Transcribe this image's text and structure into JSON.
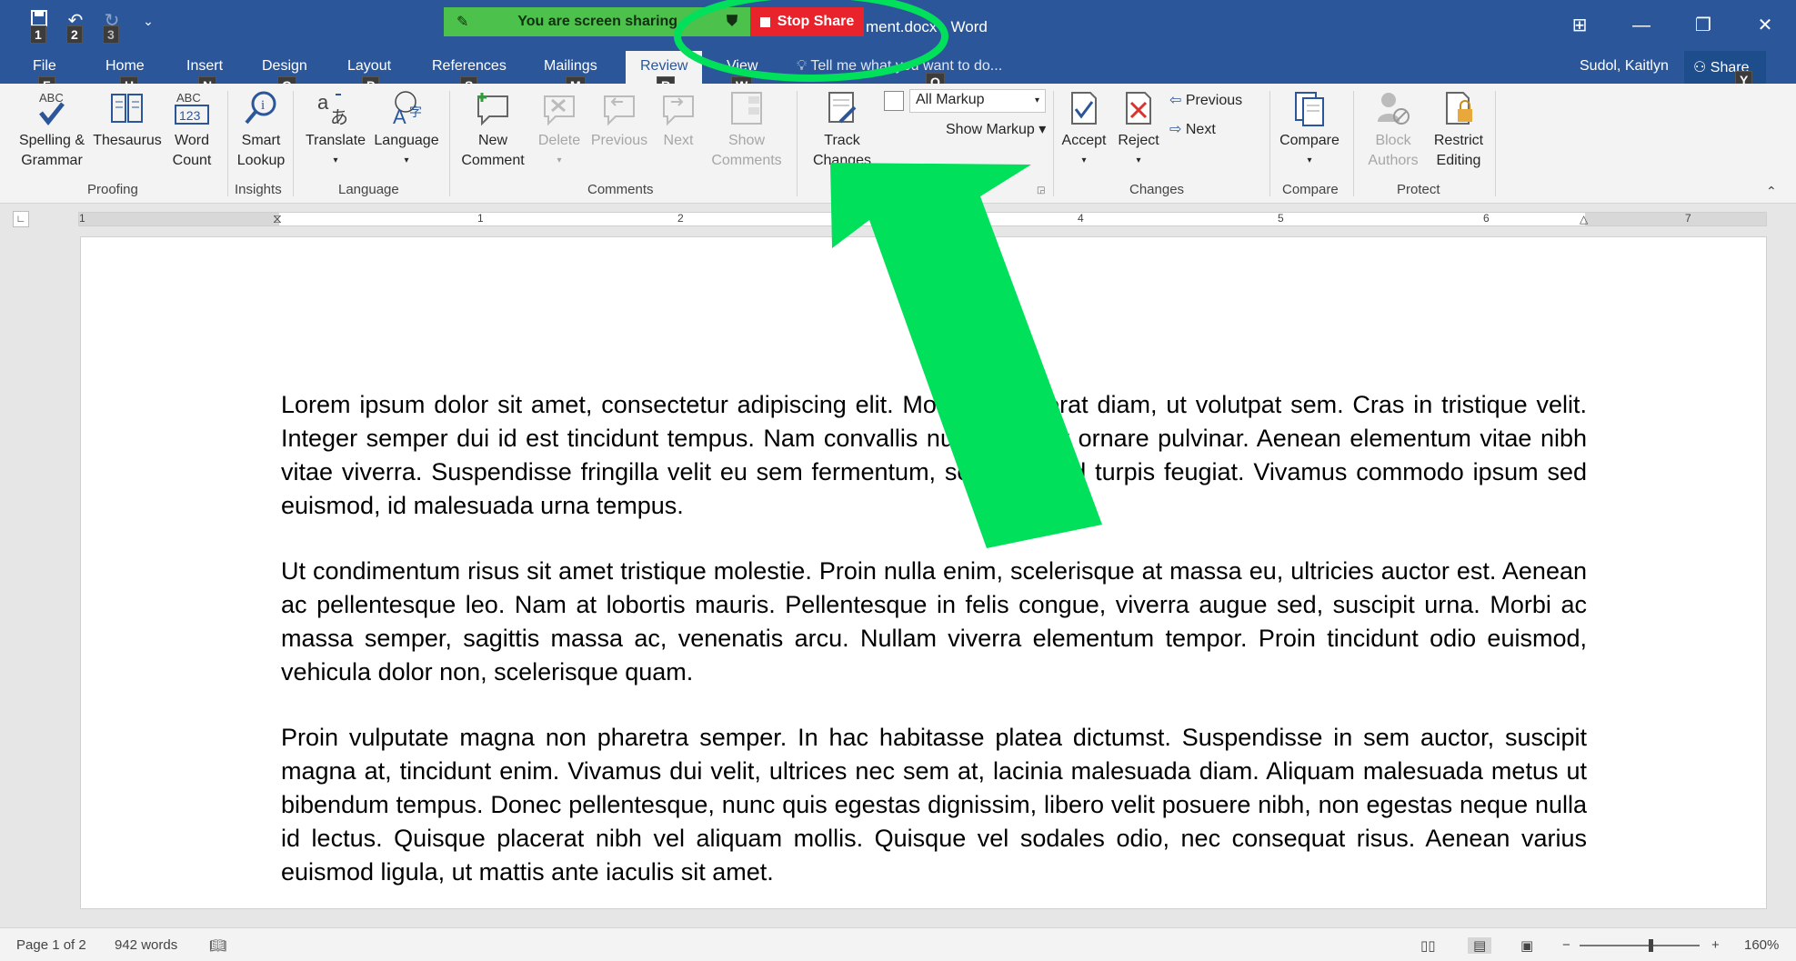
{
  "window": {
    "title": "ment.docx - Word",
    "controls": [
      "ribbon-display",
      "minimize",
      "restore",
      "close"
    ]
  },
  "share_banner": {
    "status": "You are screen sharing",
    "stop_label": "Stop Share"
  },
  "qat_keytips": [
    "1",
    "2",
    "3"
  ],
  "tabs": [
    {
      "label": "File",
      "keytip": "F"
    },
    {
      "label": "Home",
      "keytip": "H"
    },
    {
      "label": "Insert",
      "keytip": "N"
    },
    {
      "label": "Design",
      "keytip": "G"
    },
    {
      "label": "Layout",
      "keytip": "P"
    },
    {
      "label": "References",
      "keytip": "S"
    },
    {
      "label": "Mailings",
      "keytip": "M"
    },
    {
      "label": "Review",
      "keytip": "R"
    },
    {
      "label": "View",
      "keytip": "W"
    }
  ],
  "tell_me": "Tell me what you want to do...",
  "tell_me_keytip": "Q",
  "user": "Sudol, Kaitlyn",
  "share_button": {
    "label": "Share",
    "keytip": "Y"
  },
  "ribbon": {
    "proofing": {
      "label": "Proofing",
      "spelling_1": "Spelling &",
      "spelling_2": "Grammar",
      "thesaurus": "Thesaurus",
      "wordcount_1": "Word",
      "wordcount_2": "Count"
    },
    "insights": {
      "label": "Insights",
      "smart_1": "Smart",
      "smart_2": "Lookup"
    },
    "language": {
      "label": "Language",
      "translate": "Translate",
      "language": "Language"
    },
    "comments": {
      "label": "Comments",
      "new_1": "New",
      "new_2": "Comment",
      "delete": "Delete",
      "previous": "Previous",
      "next": "Next",
      "show_1": "Show",
      "show_2": "Comments"
    },
    "tracking": {
      "track_1": "Track",
      "track_2": "Changes",
      "markup_value": "All Markup",
      "show_markup": "Show Markup"
    },
    "changes": {
      "label": "Changes",
      "accept": "Accept",
      "reject": "Reject",
      "previous": "Previous",
      "next": "Next"
    },
    "compare": {
      "label": "Compare",
      "compare": "Compare"
    },
    "protect": {
      "label": "Protect",
      "block_1": "Block",
      "block_2": "Authors",
      "restrict_1": "Restrict",
      "restrict_2": "Editing"
    }
  },
  "ruler_numbers": [
    "1",
    "1",
    "2",
    "3",
    "4",
    "5",
    "6",
    "7"
  ],
  "document": {
    "paragraphs": [
      "Lorem ipsum dolor sit amet, consectetur adipiscing elit. Morbi id placerat diam, ut volutpat sem. Cras in tristique velit. Integer semper dui id est tincidunt tempus. Nam convallis nulla non est ornare pulvinar. Aenean elementum vitae nibh vitae viverra. Suspendisse fringilla velit eu sem fermentum, sed euismod turpis feugiat. Vivamus commodo ipsum sed euismod, id malesuada urna tempus.",
      "Ut condimentum risus sit amet tristique molestie. Proin nulla enim, scelerisque at massa eu, ultricies auctor est. Aenean ac pellentesque leo. Nam at lobortis mauris. Pellentesque in felis congue, viverra augue sed, suscipit urna. Morbi ac massa semper, sagittis massa ac, venenatis arcu. Nullam viverra elementum tempor. Proin tincidunt odio euismod, vehicula dolor non, scelerisque quam.",
      "Proin vulputate magna non pharetra semper. In hac habitasse platea dictumst. Suspendisse in sem auctor, suscipit magna at, tincidunt enim. Vivamus dui velit, ultrices nec sem at, lacinia malesuada diam. Aliquam malesuada metus ut bibendum tempus. Donec pellentesque, nunc quis egestas dignissim, libero velit posuere nibh, non egestas neque nulla id lectus. Quisque placerat nibh vel aliquam mollis. Quisque vel sodales odio, nec consequat risus. Aenean varius euismod ligula, ut mattis ante iaculis sit amet."
    ]
  },
  "status": {
    "page": "Page 1 of 2",
    "words": "942 words",
    "zoom": "160%",
    "zoom_percent": 160
  },
  "colors": {
    "title_bar": "#2b579a",
    "share_green": "#4cc14c",
    "stop_red": "#e8232b",
    "annotation_green": "#00e05a"
  }
}
